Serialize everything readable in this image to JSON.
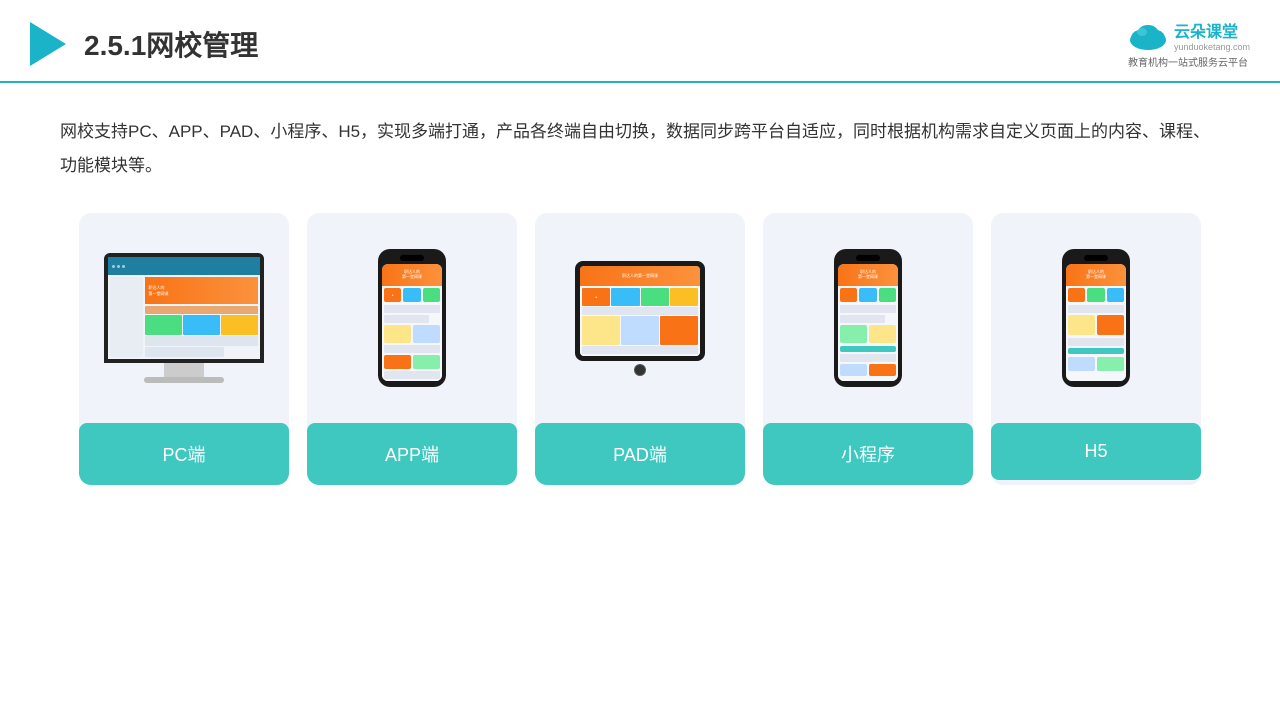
{
  "header": {
    "title": "2.5.1网校管理",
    "logo_name": "云朵课堂",
    "logo_url": "yunduoketang.com",
    "logo_tagline": "教育机构一站式服务云平台"
  },
  "description": {
    "text": "网校支持PC、APP、PAD、小程序、H5，实现多端打通，产品各终端自由切换，数据同步跨平台自适应，同时根据机构需求自定义页面上的内容、课程、功能模块等。"
  },
  "cards": [
    {
      "id": "pc",
      "label": "PC端"
    },
    {
      "id": "app",
      "label": "APP端"
    },
    {
      "id": "pad",
      "label": "PAD端"
    },
    {
      "id": "miniapp",
      "label": "小程序"
    },
    {
      "id": "h5",
      "label": "H5"
    }
  ],
  "accent_color": "#3ec8c0",
  "header_line_color": "#1ab3c8"
}
